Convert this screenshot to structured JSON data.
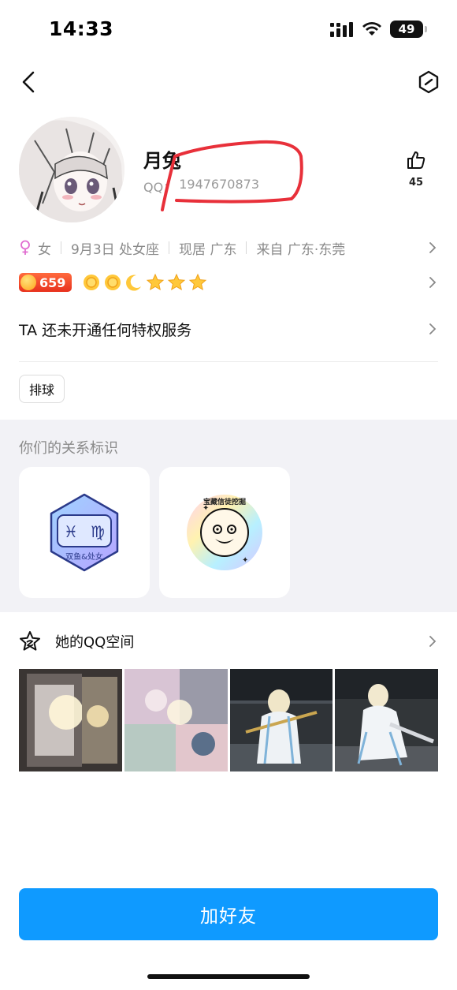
{
  "status": {
    "time": "14:33",
    "battery": "49"
  },
  "profile": {
    "nickname": "月兔",
    "qq_label": "QQ：",
    "qq_number": "1947670873",
    "likes": "45"
  },
  "info": {
    "gender": "女",
    "birthday": "9月3日 处女座",
    "location": "现居 广东",
    "hometown": "来自 广东·东莞"
  },
  "level": {
    "value": "659"
  },
  "privilege": {
    "text": "TA 还未开通任何特权服务"
  },
  "tags": [
    "排球"
  ],
  "relation": {
    "title": "你们的关系标识",
    "badge1_label": "双鱼&处女",
    "badge2_text": "宝藏信徒挖掘"
  },
  "qzone": {
    "title": "她的QQ空间"
  },
  "actions": {
    "add_friend": "加好友"
  },
  "colors": {
    "accent": "#0f9aff",
    "scribble": "#e8303a"
  }
}
